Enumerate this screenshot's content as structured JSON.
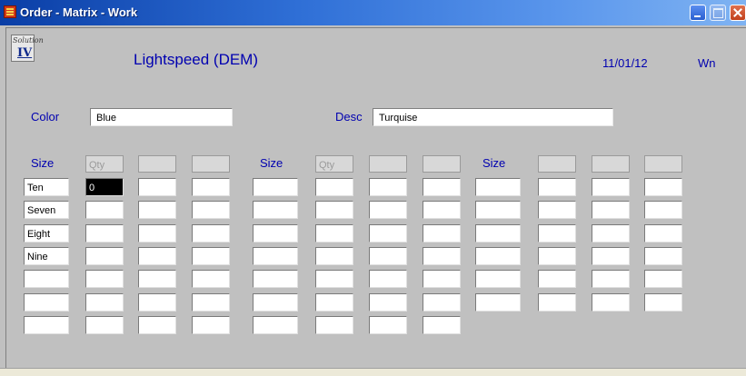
{
  "window": {
    "title": "Order - Matrix - Work"
  },
  "header": {
    "logo_text_top": "Solution",
    "logo_text_main": "IV",
    "app_title": "Lightspeed (DEM)",
    "date": "11/01/12",
    "user": "Wn"
  },
  "fields": {
    "color_label": "Color",
    "color_value": "Blue",
    "desc_label": "Desc",
    "desc_value": "Turquise"
  },
  "grid": {
    "groups": [
      {
        "size_label": "Size",
        "qty_header": "Qty",
        "sizes": [
          "Ten",
          "Seven",
          "Eight",
          "Nine",
          "",
          "",
          ""
        ]
      },
      {
        "size_label": "Size",
        "qty_header": "Qty",
        "sizes": [
          "",
          "",
          "",
          "",
          "",
          "",
          ""
        ]
      },
      {
        "size_label": "Size",
        "qty_header": "",
        "sizes": [
          "",
          "",
          "",
          "",
          "",
          ""
        ]
      }
    ],
    "active_value": "0"
  }
}
